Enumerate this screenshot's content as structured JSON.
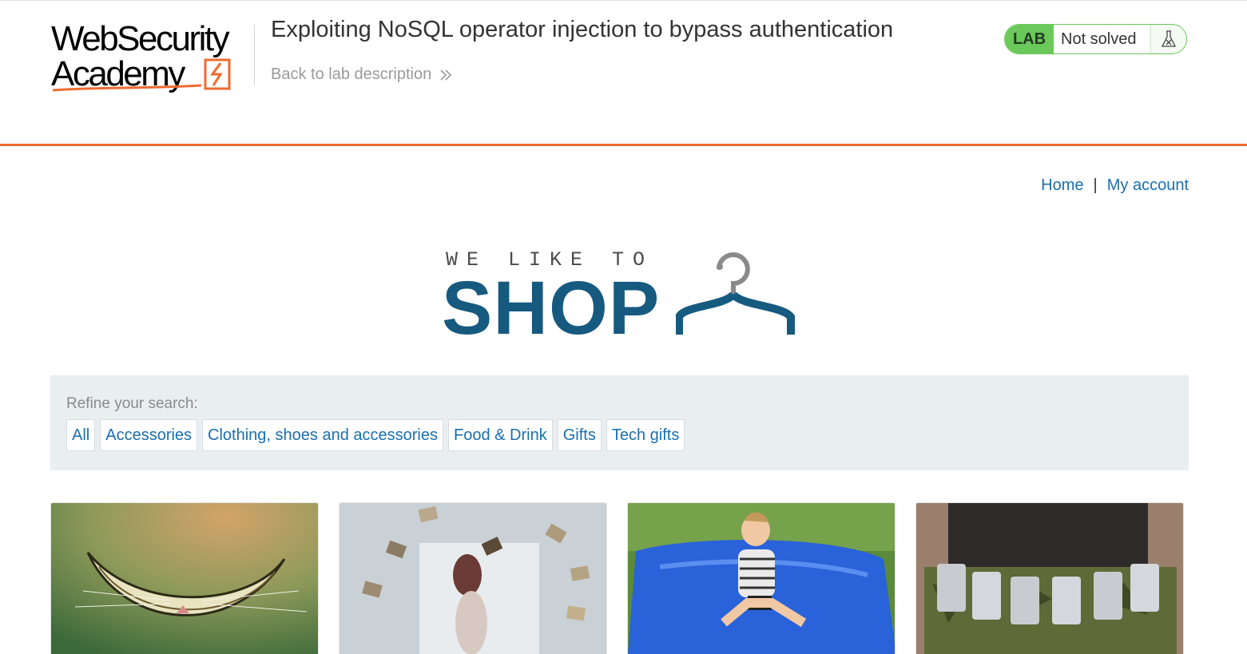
{
  "academy": {
    "logo_line1": "WebSecurity",
    "logo_line2": "Academy",
    "lab_title": "Exploiting NoSQL operator injection to bypass authentication",
    "back_link": "Back to lab description",
    "lab_badge": "LAB",
    "lab_status": "Not solved",
    "brand_orange": "#ef6a2f",
    "status_green": "#6bc85a"
  },
  "nav": {
    "home": "Home",
    "separator": "|",
    "my_account": "My account",
    "link_color": "#1a6fb0"
  },
  "banner": {
    "tagline": "WE LIKE TO",
    "title": "SHOP",
    "icon": "hanger-icon",
    "title_color": "#165a80"
  },
  "filters": {
    "label": "Refine your search:",
    "options": [
      "All",
      "Accessories",
      "Clothing, shoes and accessories",
      "Food & Drink",
      "Gifts",
      "Tech gifts"
    ]
  },
  "products": [
    {
      "image": "cheshire-grin-image"
    },
    {
      "image": "floating-books-image"
    },
    {
      "image": "bean-bag-image"
    },
    {
      "image": "beer-belt-image"
    }
  ]
}
